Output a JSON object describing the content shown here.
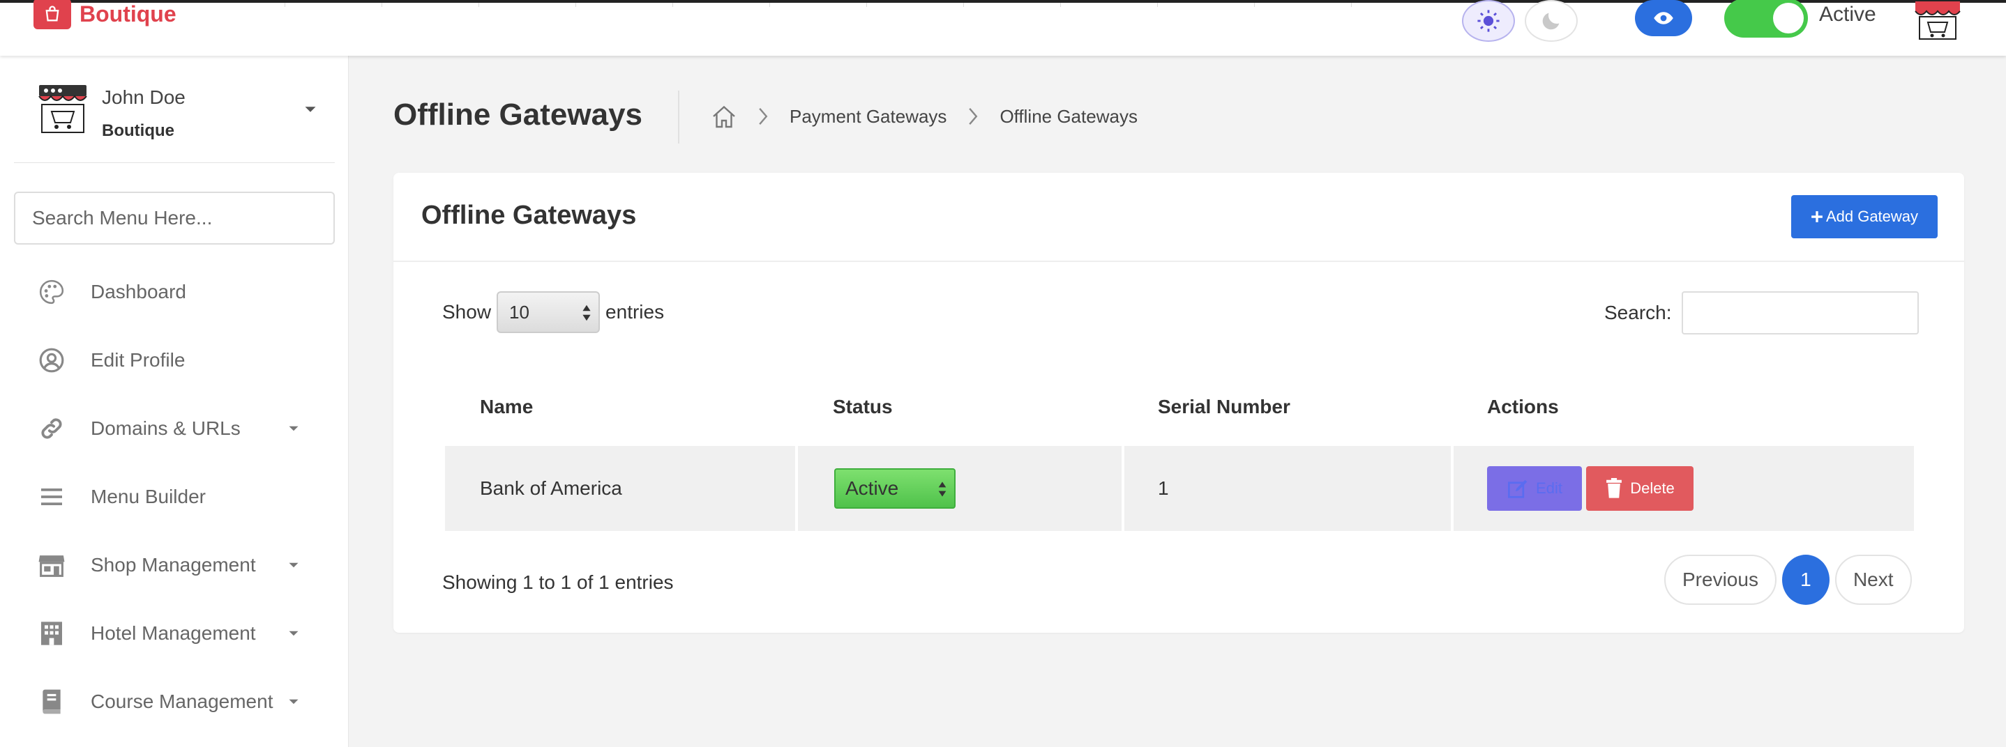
{
  "brand": {
    "name": "Boutique",
    "color": "#e0424d"
  },
  "topbar": {
    "light_mode_icon": "sun-icon",
    "dark_mode_icon": "moon-icon",
    "preview_icon": "eye-icon",
    "status_label": "Active",
    "status_on": true
  },
  "sidebar": {
    "user": {
      "name": "John Doe",
      "shop": "Boutique"
    },
    "search_placeholder": "Search Menu Here...",
    "items": [
      {
        "label": "Dashboard",
        "icon": "palette-icon",
        "has_submenu": false
      },
      {
        "label": "Edit Profile",
        "icon": "user-circle-icon",
        "has_submenu": false
      },
      {
        "label": "Domains & URLs",
        "icon": "link-icon",
        "has_submenu": true
      },
      {
        "label": "Menu Builder",
        "icon": "bars-icon",
        "has_submenu": false
      },
      {
        "label": "Shop Management",
        "icon": "store-icon",
        "has_submenu": true
      },
      {
        "label": "Hotel Management",
        "icon": "building-icon",
        "has_submenu": true
      },
      {
        "label": "Course Management",
        "icon": "book-icon",
        "has_submenu": true
      }
    ]
  },
  "page": {
    "title": "Offline Gateways",
    "breadcrumb": [
      "Payment Gateways",
      "Offline Gateways"
    ]
  },
  "card": {
    "title": "Offline Gateways",
    "add_button": "Add Gateway",
    "show_label": "Show",
    "entries_value": "10",
    "entries_label": "entries",
    "search_label": "Search:",
    "columns": [
      "Name",
      "Status",
      "Serial Number",
      "Actions"
    ],
    "rows": [
      {
        "name": "Bank of America",
        "status": "Active",
        "serial": "1",
        "edit": "Edit",
        "delete": "Delete"
      }
    ],
    "info": "Showing 1 to 1 of 1 entries",
    "pagination": {
      "previous": "Previous",
      "current": "1",
      "next": "Next"
    }
  },
  "colors": {
    "primary": "#2b6fdf",
    "success": "#4fc24b",
    "danger": "#e15a5e",
    "edit": "#7b6ee6"
  }
}
